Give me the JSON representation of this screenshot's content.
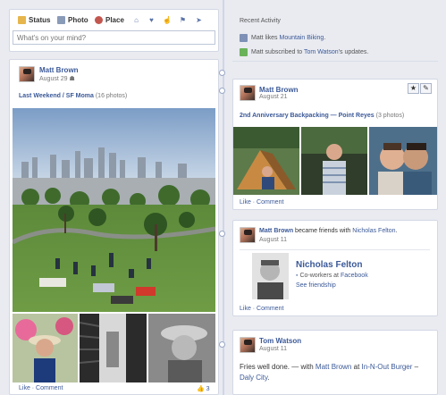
{
  "composer": {
    "tabs": [
      {
        "label": "Status",
        "icon": "status-icon"
      },
      {
        "label": "Photo",
        "icon": "photo-icon"
      },
      {
        "label": "Place",
        "icon": "place-icon"
      }
    ],
    "extra_icons": [
      "home-icon",
      "heart-icon",
      "thumbs-icon",
      "flag-icon"
    ],
    "placeholder": "What's on your mind?"
  },
  "recent_activity": {
    "title": "Recent Activity",
    "items": [
      {
        "prefix": "Matt likes ",
        "link": "Mountain Biking",
        "suffix": ".",
        "icon": "like-page-icon"
      },
      {
        "prefix": "Matt subscribed to ",
        "link": "Tom Watson",
        "suffix": "'s updates.",
        "icon": "subscribe-icon"
      }
    ]
  },
  "post_album": {
    "author": "Matt Brown",
    "date": "August 29",
    "album_link": "Last Weekend / SF Moma",
    "album_count": "(16 photos)",
    "actions": "Like · Comment",
    "like_count": "3"
  },
  "post_backpacking": {
    "author": "Matt Brown",
    "date": "August 21",
    "album_link": "2nd Anniversary Backpacking — Point Reyes",
    "album_count": "(3 photos)",
    "actions": "Like · Comment",
    "star_btn": "★",
    "edit_btn": "✎"
  },
  "post_friends": {
    "author": "Matt Brown",
    "text_mid": " became friends with ",
    "friend": "Nicholas Felton",
    "text_end": ".",
    "date": "August 11",
    "card_name": "Nicholas Felton",
    "card_sub_prefix": "Co-workers at ",
    "card_sub_link": "Facebook",
    "see_friendship": "See friendship",
    "actions": "Like · Comment"
  },
  "post_status": {
    "author": "Tom Watson",
    "date": "August 11",
    "text_start": "Fries well done. — with ",
    "with_name": "Matt Brown",
    "at": " at ",
    "place": "In-N-Out Burger",
    "place_suffix": " –",
    "city": "Daly City",
    "city_suffix": "."
  }
}
